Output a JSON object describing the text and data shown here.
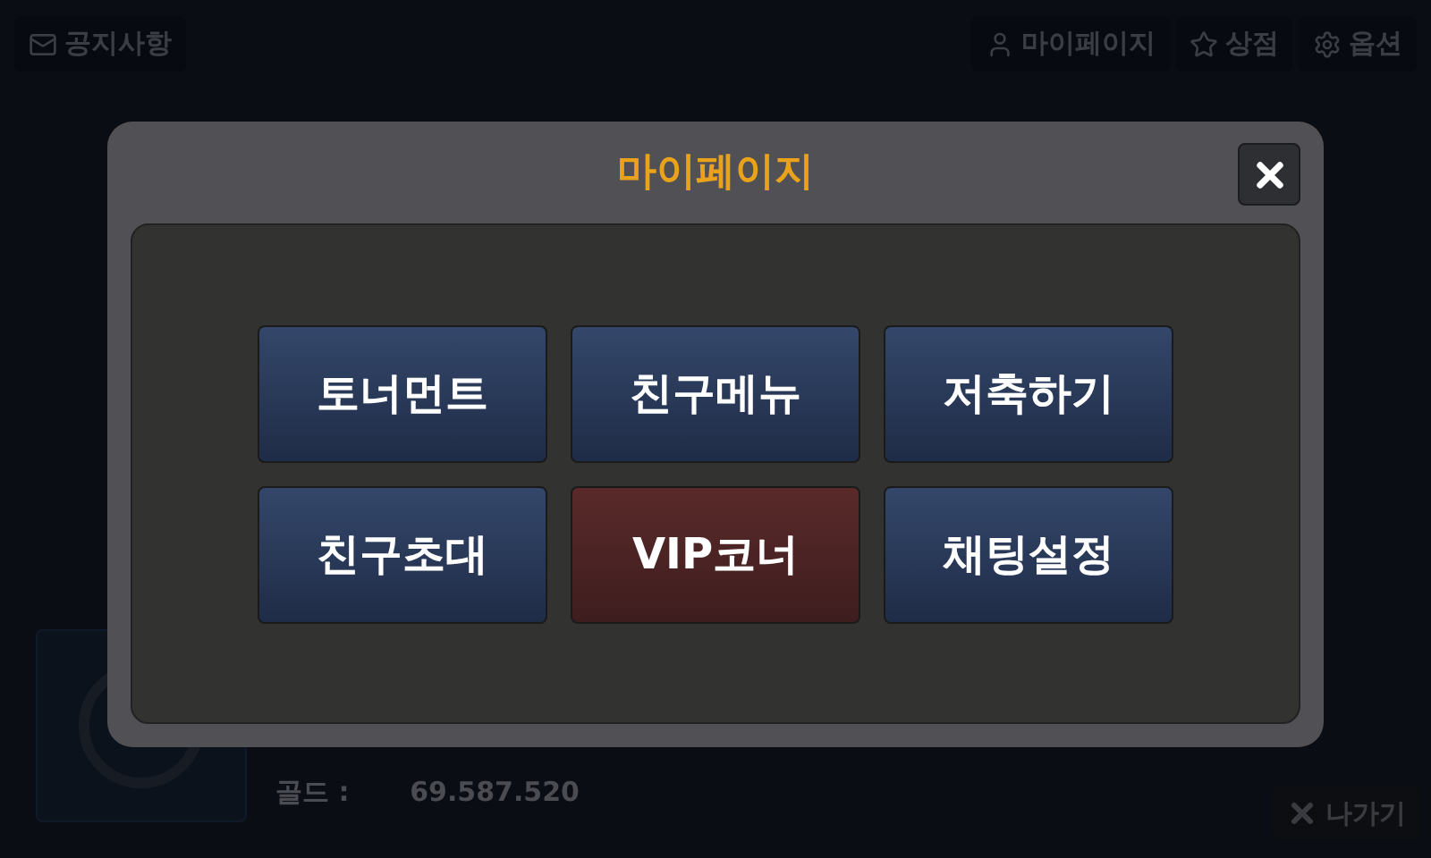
{
  "top_bar": {
    "left": [
      {
        "label": "공지사항",
        "kind": "notice"
      }
    ],
    "right": [
      {
        "label": "마이페이지",
        "kind": "mypage"
      },
      {
        "label": "상점",
        "kind": "shop"
      },
      {
        "label": "옵션",
        "kind": "options"
      }
    ]
  },
  "profile": {
    "stats": [
      {
        "label": "골드 :",
        "value": "69.587.520"
      }
    ]
  },
  "exit_button": {
    "label": "나가기"
  },
  "dialog": {
    "title": "마이페이지",
    "buttons": [
      {
        "label": "토너먼트",
        "kind": "normal"
      },
      {
        "label": "친구메뉴",
        "kind": "normal"
      },
      {
        "label": "저축하기",
        "kind": "normal"
      },
      {
        "label": "친구초대",
        "kind": "normal"
      },
      {
        "label": "VIP코너",
        "kind": "vip"
      },
      {
        "label": "채팅설정",
        "kind": "normal"
      }
    ]
  }
}
